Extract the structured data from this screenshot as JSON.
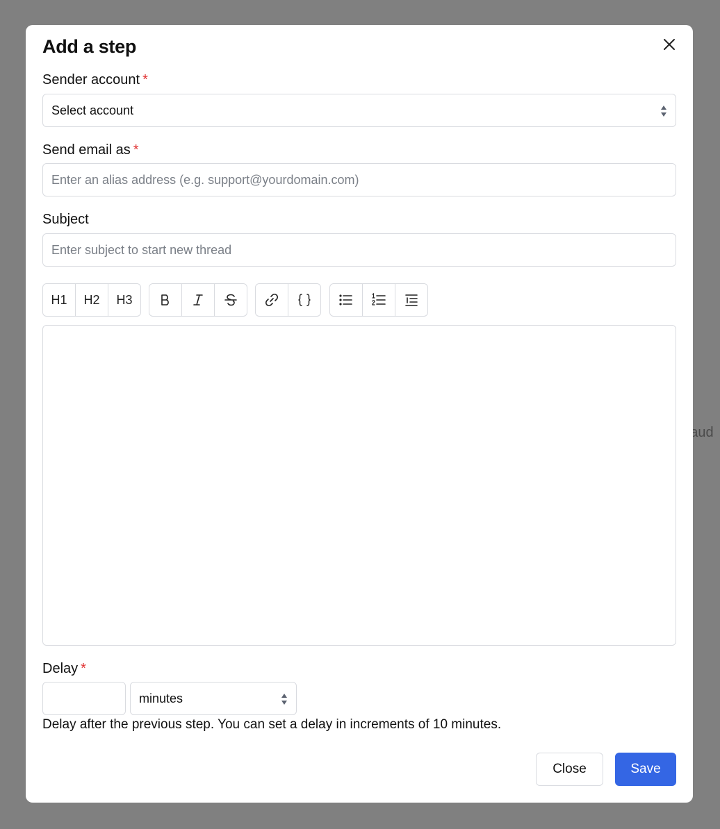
{
  "background": {
    "partial_text": "r aud"
  },
  "modal": {
    "title": "Add a step",
    "close_icon": "close-icon"
  },
  "sender_account": {
    "label": "Sender account",
    "required_mark": "*",
    "value": "Select account"
  },
  "send_email_as": {
    "label": "Send email as",
    "required_mark": "*",
    "placeholder": "Enter an alias address (e.g. support@yourdomain.com)",
    "value": ""
  },
  "subject": {
    "label": "Subject",
    "placeholder": "Enter subject to start new thread",
    "value": ""
  },
  "toolbar": {
    "h1": "H1",
    "h2": "H2",
    "h3": "H3",
    "icons": [
      "bold-icon",
      "italic-icon",
      "strikethrough-icon",
      "link-icon",
      "code-braces-icon",
      "bullet-list-icon",
      "numbered-list-icon",
      "indent-list-icon"
    ]
  },
  "editor": {
    "content": ""
  },
  "delay": {
    "label": "Delay",
    "required_mark": "*",
    "value": "",
    "unit": "minutes",
    "help": "Delay after the previous step. You can set a delay in increments of 10 minutes."
  },
  "footer": {
    "close_label": "Close",
    "save_label": "Save"
  },
  "colors": {
    "primary": "#3466e4",
    "required": "#e03131",
    "overlay": "#808080",
    "border": "#d9dbe0"
  }
}
